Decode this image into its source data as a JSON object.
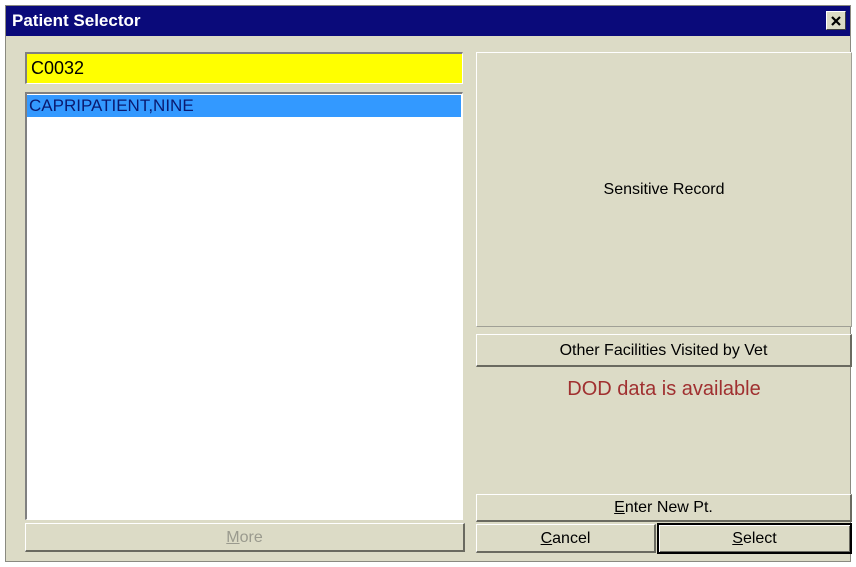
{
  "window": {
    "title": "Patient Selector",
    "close_icon": "close-icon"
  },
  "search": {
    "value": "C0032"
  },
  "patient_list": {
    "items": [
      "CAPRIPATIENT,NINE"
    ],
    "selected_index": 0
  },
  "buttons": {
    "more_prefix": "M",
    "more_rest": "ore",
    "other_facilities": "Other Facilities Visited by Vet",
    "enter_new_prefix": "E",
    "enter_new_rest": "nter New Pt.",
    "cancel_prefix": "C",
    "cancel_rest": "ancel",
    "select_prefix": "S",
    "select_rest": "elect"
  },
  "sensitive_record": {
    "label": "Sensitive Record"
  },
  "status": {
    "dod_message": "DOD data is available"
  },
  "colors": {
    "title_bar": "#0a0a7a",
    "dialog_bg": "#dcdbc6",
    "search_bg": "#ffff00",
    "selection": "#3399ff",
    "dod_text": "#a03030"
  }
}
